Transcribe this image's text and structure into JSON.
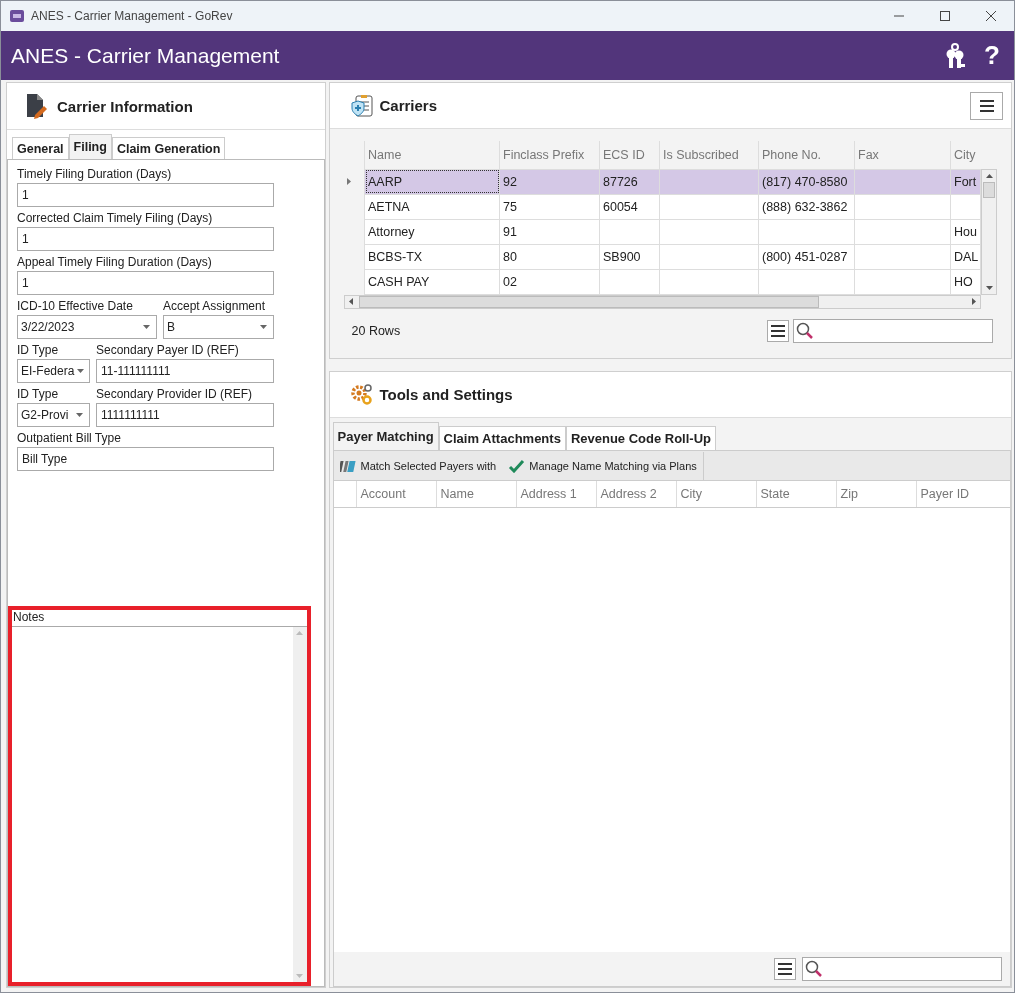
{
  "window": {
    "title": "ANES - Carrier Management - GoRev"
  },
  "header": {
    "title": "ANES - Carrier Management",
    "help": "?"
  },
  "carrier_information": {
    "title": "Carrier Information",
    "tabs": [
      {
        "label": "General",
        "selected": false
      },
      {
        "label": "Filing",
        "selected": true
      },
      {
        "label": "Claim Generation",
        "selected": false
      }
    ],
    "field_rows": [
      [
        {
          "label": "Timely Filing Duration (Days)",
          "value": "1",
          "kind": "text"
        }
      ],
      [
        {
          "label": "Corrected Claim Timely Filing (Days)",
          "value": "1",
          "kind": "text"
        }
      ],
      [
        {
          "label": "Appeal Timely Filing Duration (Days)",
          "value": "1",
          "kind": "text"
        }
      ],
      [
        {
          "label": "ICD-10 Effective Date",
          "value": "3/22/2023",
          "kind": "date"
        },
        {
          "label": "Accept Assignment",
          "value": "B",
          "kind": "dropdown"
        }
      ],
      [
        {
          "label": "ID Type",
          "value": "EI-Federa",
          "kind": "dropdown"
        },
        {
          "label": "Secondary Payer ID (REF)",
          "value": "11-111111111",
          "kind": "text"
        }
      ],
      [
        {
          "label": "ID Type",
          "value": "G2-Provi",
          "kind": "dropdown"
        },
        {
          "label": "Secondary Provider ID (REF)",
          "value": "1111111111",
          "kind": "text"
        }
      ],
      [
        {
          "label": "Outpatient Bill Type",
          "value": "Bill Type",
          "kind": "text"
        }
      ]
    ],
    "notes": {
      "label": "Notes",
      "highlighted": true
    }
  },
  "carriers": {
    "title": "Carriers",
    "columns": [
      "Name",
      "Finclass Prefix",
      "ECS ID",
      "Is Subscribed",
      "Phone No.",
      "Fax",
      "City"
    ],
    "rows": [
      {
        "selected": true,
        "cells": [
          "AARP",
          "92",
          "87726",
          "",
          "(817) 470-8580",
          "",
          "Fort"
        ]
      },
      {
        "selected": false,
        "cells": [
          "AETNA",
          "75",
          "60054",
          "",
          "(888) 632-3862",
          "",
          ""
        ]
      },
      {
        "selected": false,
        "cells": [
          "Attorney",
          "91",
          "",
          "",
          "",
          "",
          "Hou"
        ]
      },
      {
        "selected": false,
        "cells": [
          "BCBS-TX",
          "80",
          "SB900",
          "",
          "(800) 451-0287",
          "",
          "DAL"
        ]
      },
      {
        "selected": false,
        "cells": [
          "CASH PAY",
          "02",
          "",
          "",
          "",
          "",
          "HO"
        ]
      }
    ],
    "row_count": "20 Rows"
  },
  "tools_and_settings": {
    "title": "Tools and Settings",
    "tabs": [
      {
        "label": "Payer Matching",
        "selected": true
      },
      {
        "label": "Claim Attachments",
        "selected": false
      },
      {
        "label": "Revenue Code Roll-Up",
        "selected": false
      }
    ],
    "toolbar": [
      {
        "label": "Match Selected Payers with",
        "kind": "books"
      },
      {
        "label": "Manage Name Matching via Plans",
        "kind": "check"
      }
    ],
    "columns": [
      "Account",
      "Name",
      "Address 1",
      "Address 2",
      "City",
      "State",
      "Zip",
      "Payer ID"
    ]
  }
}
